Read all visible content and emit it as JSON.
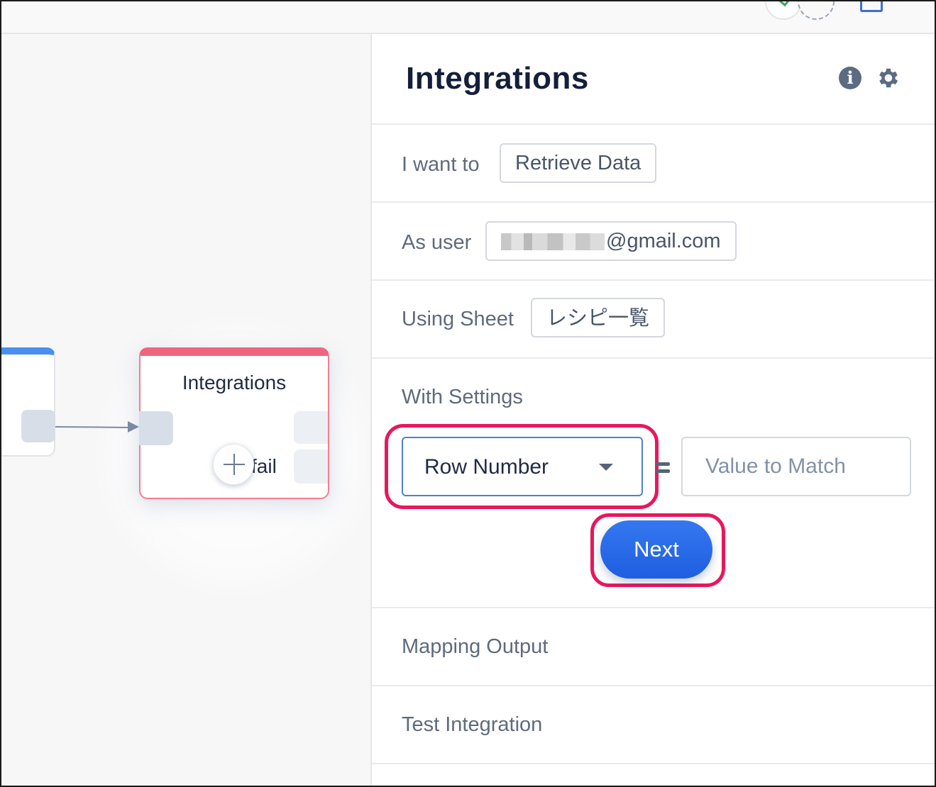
{
  "topbar": {
    "avatar_icon": "check-avatar-icon",
    "add_collaborator_icon": "add-collaborator-icon",
    "doc_icon": "document-icon"
  },
  "canvas": {
    "node": {
      "title": "Integrations",
      "fail_label": "fail",
      "accent_color": "#f0657e"
    },
    "left_node_accent": "#4a8ff0"
  },
  "panel": {
    "title": "Integrations",
    "action_row": {
      "label": "I want to",
      "value": "Retrieve Data"
    },
    "user_row": {
      "label": "As user",
      "value_suffix": "@gmail.com"
    },
    "sheet_row": {
      "label": "Using Sheet",
      "value": "レシピ一覧"
    },
    "settings": {
      "label": "With Settings",
      "field_select": "Row Number",
      "value_placeholder": "Value to Match",
      "next_label": "Next"
    },
    "mapping_label": "Mapping Output",
    "test_label": "Test Integration",
    "highlight_color": "#e8175d",
    "primary_color": "#2567e8"
  }
}
